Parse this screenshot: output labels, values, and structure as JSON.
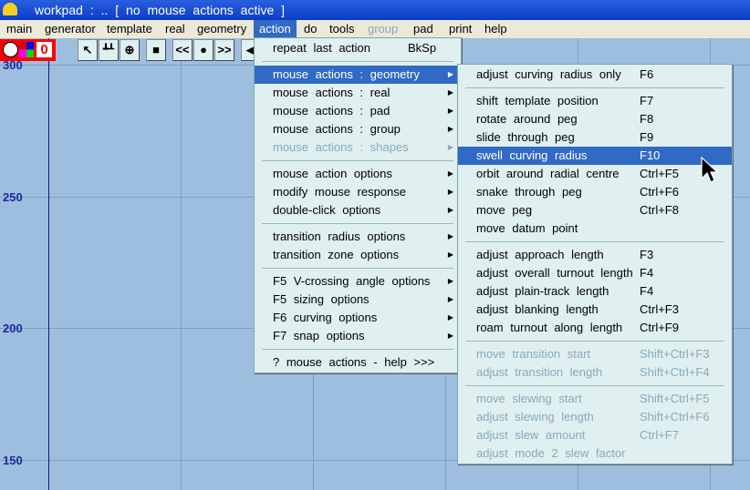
{
  "title": "workpad :  ..   [ no mouse actions active ]",
  "menubar": [
    "main",
    "generator",
    "template",
    "real",
    "geometry",
    "action",
    "do",
    "tools",
    "group",
    "pad",
    "print",
    "help"
  ],
  "toolbar": {
    "counter": "0",
    "buttons": [
      "pointer-icon",
      "peg-icon",
      "wheel-icon",
      "select-icon",
      "<<",
      "●",
      ">>",
      "left-icon"
    ]
  },
  "y_labels": [
    "300",
    "250",
    "200",
    "150"
  ],
  "action_menu": [
    {
      "label": "repeat  last  action",
      "shortcut": "BkSp"
    },
    {
      "sep": true
    },
    {
      "label": "mouse  actions :  geometry",
      "sub": true,
      "selected": true
    },
    {
      "label": "mouse  actions :  real",
      "sub": true
    },
    {
      "label": "mouse  actions :  pad",
      "sub": true
    },
    {
      "label": "mouse  actions :  group",
      "sub": true
    },
    {
      "label": "mouse  actions :  shapes",
      "sub": true,
      "disabled": true
    },
    {
      "sep": true
    },
    {
      "label": "mouse  action  options",
      "sub": true
    },
    {
      "label": "modify  mouse  response",
      "sub": true
    },
    {
      "label": "double-click  options",
      "sub": true
    },
    {
      "sep": true
    },
    {
      "label": "transition  radius  options",
      "sub": true
    },
    {
      "label": "transition  zone  options",
      "sub": true
    },
    {
      "sep": true
    },
    {
      "label": "F5  V-crossing  angle  options",
      "sub": true
    },
    {
      "label": "F5  sizing  options",
      "sub": true
    },
    {
      "label": "F6  curving  options",
      "sub": true
    },
    {
      "label": "F7  snap  options",
      "sub": true
    },
    {
      "sep": true
    },
    {
      "label": "? mouse  actions  -  help  >>>"
    }
  ],
  "geometry_menu": [
    {
      "label": "adjust  curving  radius  only",
      "shortcut": "F6"
    },
    {
      "sep": true
    },
    {
      "label": "shift  template  position",
      "shortcut": "F7"
    },
    {
      "label": "rotate  around  peg",
      "shortcut": "F8"
    },
    {
      "label": "slide  through  peg",
      "shortcut": "F9"
    },
    {
      "label": "swell  curving  radius",
      "shortcut": "F10",
      "selected": true
    },
    {
      "label": "orbit  around  radial  centre",
      "shortcut": "Ctrl+F5"
    },
    {
      "label": "snake  through  peg",
      "shortcut": "Ctrl+F6"
    },
    {
      "label": "move  peg",
      "shortcut": "Ctrl+F8"
    },
    {
      "label": "move  datum  point",
      "shortcut": ""
    },
    {
      "sep": true
    },
    {
      "label": "adjust  approach  length",
      "shortcut": "F3"
    },
    {
      "label": "adjust  overall  turnout  length",
      "shortcut": "F4"
    },
    {
      "label": "adjust  plain-track  length",
      "shortcut": "F4"
    },
    {
      "label": "adjust  blanking  length",
      "shortcut": "Ctrl+F3"
    },
    {
      "label": "roam  turnout  along  length",
      "shortcut": "Ctrl+F9"
    },
    {
      "sep": true
    },
    {
      "label": "move  transition  start",
      "shortcut": "Shift+Ctrl+F3",
      "disabled": true
    },
    {
      "label": "adjust  transition  length",
      "shortcut": "Shift+Ctrl+F4",
      "disabled": true
    },
    {
      "sep": true
    },
    {
      "label": "move  slewing  start",
      "shortcut": "Shift+Ctrl+F5",
      "disabled": true
    },
    {
      "label": "adjust  slewing  length",
      "shortcut": "Shift+Ctrl+F6",
      "disabled": true
    },
    {
      "label": "adjust  slew  amount",
      "shortcut": "Ctrl+F7",
      "disabled": true
    },
    {
      "label": "adjust  mode  2  slew  factor",
      "shortcut": "",
      "disabled": true
    }
  ]
}
